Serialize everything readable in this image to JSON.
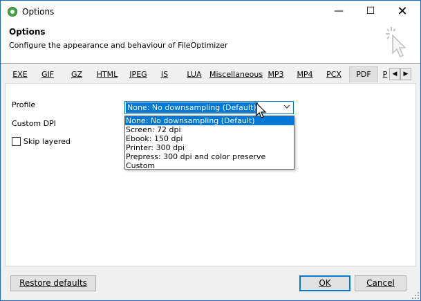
{
  "window": {
    "title": "Options",
    "controls": {
      "minimize": "—",
      "maximize": "☐",
      "close": "✕"
    }
  },
  "header": {
    "title": "Options",
    "description": "Configure the appearance and behaviour of FileOptimizer",
    "icon": "cursor-click-icon"
  },
  "tabs": [
    "EXE",
    "GIF",
    "GZ",
    "HTML",
    "JPEG",
    "JS",
    "LUA",
    "Miscellaneous",
    "MP3",
    "MP4",
    "PCX",
    "PDF",
    "P"
  ],
  "active_tab": "PDF",
  "pdf": {
    "profile_label": "Profile",
    "custom_dpi_label": "Custom DPI",
    "skip_layered_label": "Skip layered",
    "skip_layered_checked": false,
    "profile_value": "None: No downsampling (Default)",
    "profile_options": [
      "None: No downsampling (Default)",
      "Screen: 72 dpi",
      "Ebook: 150 dpi",
      "Printer: 300 dpi",
      "Prepress: 300 dpi and color preserve",
      "Custom"
    ]
  },
  "buttons": {
    "restore": "Restore defaults",
    "ok": "OK",
    "cancel": "Cancel"
  },
  "colors": {
    "accent": "#0078d7",
    "window_border": "#1b6ac9"
  }
}
